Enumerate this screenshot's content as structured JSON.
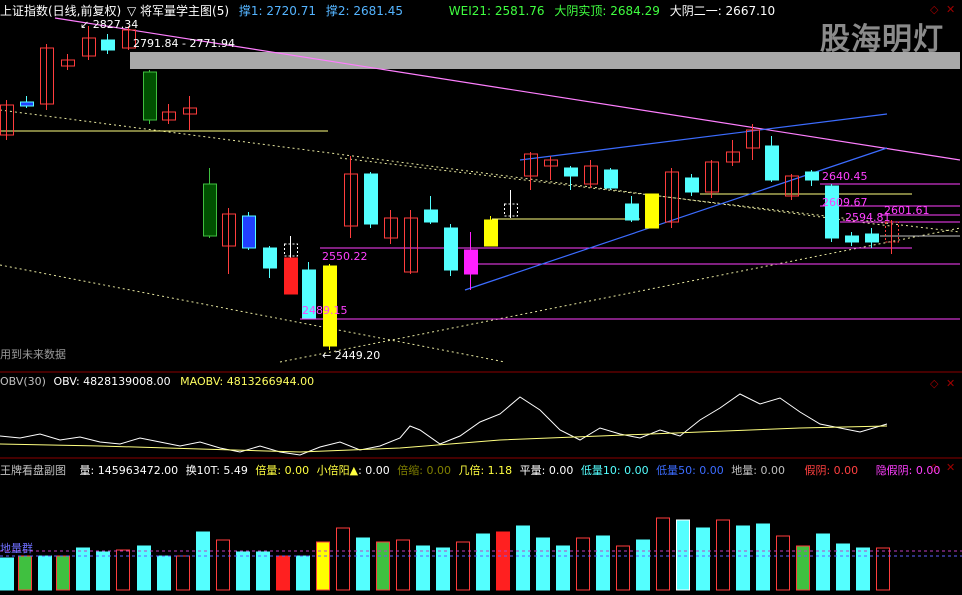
{
  "main_header": {
    "title": "上证指数(日线,前复权)",
    "indicator": "▽ 将军量学主图(5)",
    "support1_label": "撑1: 2720.71",
    "support2_label": "撑2: 2681.45",
    "wei21_label": "WEI21: 2581.76",
    "dayin_shishi_label": "大阴实顶: 2684.29",
    "dayin_erer_label": "大阴二一: 2667.10"
  },
  "price_labels": {
    "high": "2827.34",
    "band": "2791.84 - 2771.94",
    "p2640": "2640.45",
    "p2609": "2609.67",
    "p2594": "2594.81",
    "p2601": "2601.61",
    "p2550": "2550.22",
    "p2489": "2489.15",
    "low": "2449.20",
    "future_note": "用到未来数据"
  },
  "obv_header": {
    "name": "OBV(30)",
    "obv": "OBV: 4828139008.00",
    "maobv": "MAOBV: 4813266944.00"
  },
  "vol_header": {
    "name": "王牌看盘副图",
    "liang": "量: 145963472.00",
    "huan": "换10T: 5.49",
    "beiliang": "倍量: 0.00",
    "xiaobeiyang": "小倍阳",
    "xiaobeiyang_val": ": 0.00",
    "beisuo": "倍缩: 0.00",
    "jibei": "几倍: 1.18",
    "pingliang": "平量: 0.00",
    "diliang10": "低量10: 0.00",
    "diliang50": "低量50: 0.00",
    "diliang": "地量: 0.00",
    "jiayin": "假阴: 0.00",
    "yinjiayin": "隐假阴: 0.00",
    "bottom_label": "地量群"
  },
  "watermark": "股海明灯",
  "colors": {
    "up": "#ff3d3d",
    "down": "#54ffff",
    "ma_yellow": "#ffff00",
    "magenta": "#ff40ff",
    "blue_line": "#3c6cff"
  }
}
